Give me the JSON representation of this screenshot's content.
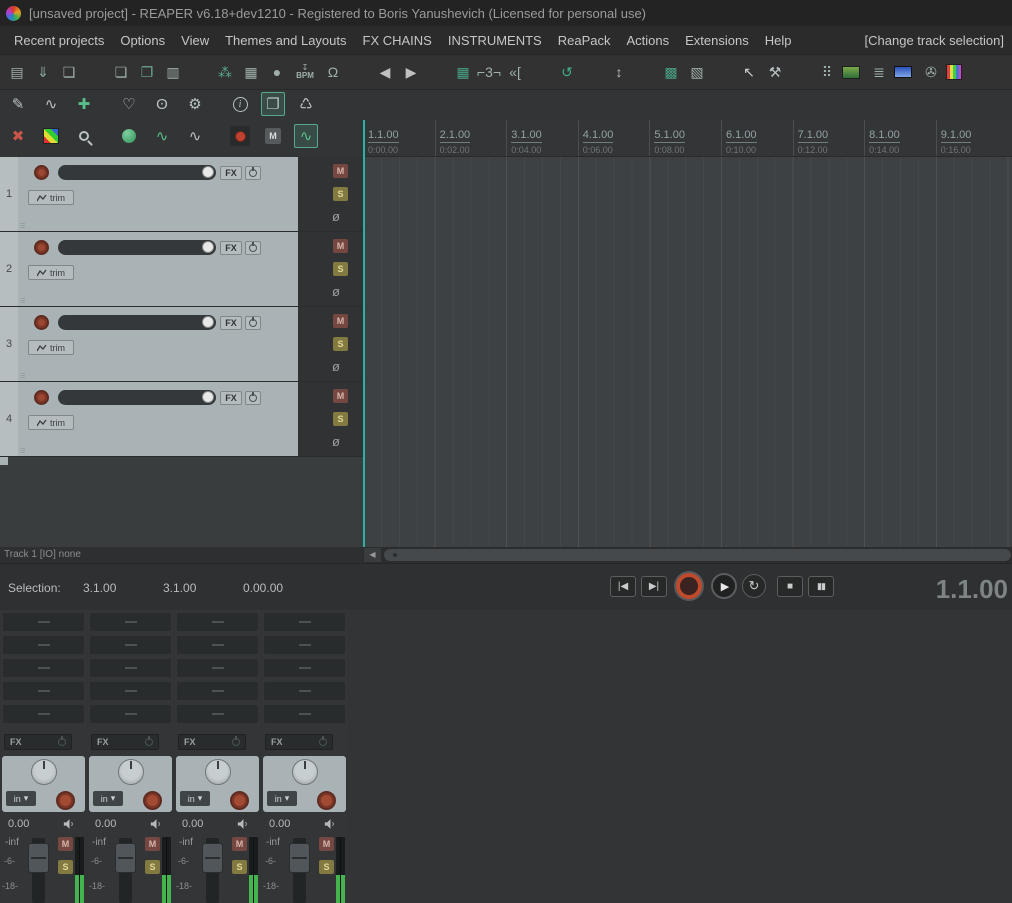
{
  "title_bar": {
    "title": "[unsaved project] - REAPER v6.18+dev1210 - Registered to Boris Yanushevich (Licensed for personal use)"
  },
  "menu": {
    "items": [
      "Recent projects",
      "Options",
      "View",
      "Themes and Layouts",
      "FX CHAINS",
      "INSTRUMENTS",
      "ReaPack",
      "Actions",
      "Extensions",
      "Help"
    ],
    "right_item": "[Change track selection]"
  },
  "toolbar": {
    "bpm_arrow": "↧",
    "bpm_label": "BPM",
    "routing_glyph": "≣",
    "tape_glyph": "✇",
    "icons_a": [
      {
        "name": "save-project-icon",
        "glyph": "▤",
        "color": "#9fb0aa"
      },
      {
        "name": "render-project-icon",
        "glyph": "⇓",
        "color": "#8fae9f"
      },
      {
        "name": "project-bay-icon",
        "glyph": "❑",
        "color": "#9fb0aa"
      },
      {
        "name": "spacer",
        "glyph": ""
      },
      {
        "name": "new-project-icon",
        "glyph": "❏",
        "color": "#9fb0aa"
      },
      {
        "name": "open-project-icon",
        "glyph": "❐",
        "color": "#6aa88f"
      },
      {
        "name": "media-explorer-icon",
        "glyph": "▥",
        "color": "#9fb0aa"
      },
      {
        "name": "spacer",
        "glyph": ""
      },
      {
        "name": "track-manager-icon",
        "glyph": "⁂",
        "color": "#5aa88a"
      },
      {
        "name": "big-clock-icon",
        "glyph": "▦",
        "color": "#9fb0aa"
      },
      {
        "name": "metronome-icon",
        "glyph": "●",
        "color": "#9fb0aa"
      }
    ],
    "icons_b": [
      {
        "name": "metronome-bell-icon",
        "glyph": "Ω",
        "color": "#9fb0aa"
      },
      {
        "name": "spacer",
        "glyph": ""
      },
      {
        "name": "go-start-arrow-icon",
        "glyph": "◀",
        "color": "#c0c0c0"
      },
      {
        "name": "play-arrow-icon",
        "glyph": "▶",
        "color": "#c0c0c0"
      },
      {
        "name": "spacer",
        "glyph": ""
      },
      {
        "name": "grid-toggle-icon",
        "glyph": "▦",
        "color": "#49a186"
      },
      {
        "name": "measure-grid-icon",
        "glyph": "⌐3¬",
        "color": "#9fb0aa"
      },
      {
        "name": "snap-toggle-icon",
        "glyph": "«[",
        "color": "#9fb0aa"
      },
      {
        "name": "spacer",
        "glyph": ""
      },
      {
        "name": "repeat-toggle-icon",
        "glyph": "↺",
        "color": "#3fae8c"
      },
      {
        "name": "spacer",
        "glyph": ""
      },
      {
        "name": "zoom-vertical-icon",
        "glyph": "↕",
        "color": "#b9c2c4"
      },
      {
        "name": "spacer",
        "glyph": ""
      },
      {
        "name": "item-select-grid-icon",
        "glyph": "▩",
        "color": "#49a186"
      },
      {
        "name": "marquee-zoom-icon",
        "glyph": "▧",
        "color": "#9fb0aa"
      },
      {
        "name": "spacer",
        "glyph": ""
      },
      {
        "name": "arrow-cursor-icon",
        "glyph": "↖",
        "color": "#d0d0d0"
      },
      {
        "name": "hammer-tool-icon",
        "glyph": "⚒",
        "color": "#b9c2c4"
      },
      {
        "name": "spacer",
        "glyph": ""
      },
      {
        "name": "dot-grid-icon",
        "glyph": "⠿",
        "color": "#9fb0aa"
      }
    ]
  },
  "tcp_toolbar": {
    "edit": "✎",
    "envelope": "∿",
    "add": "✚",
    "heart": "♡",
    "mic": "ʘ",
    "wrench": "⚙",
    "info": "i",
    "duplicate": "❐",
    "trash": "♺",
    "close": "✖",
    "env_a": "∿",
    "env_b": "∿",
    "mute": "M",
    "env_active": "∿"
  },
  "ruler": {
    "marks": [
      {
        "beat": "1.1.00",
        "time": "0:00.00"
      },
      {
        "beat": "2.1.00",
        "time": "0:02.00"
      },
      {
        "beat": "3.1.00",
        "time": "0:04.00"
      },
      {
        "beat": "4.1.00",
        "time": "0:06.00"
      },
      {
        "beat": "5.1.00",
        "time": "0:08.00"
      },
      {
        "beat": "6.1.00",
        "time": "0:10.00"
      },
      {
        "beat": "7.1.00",
        "time": "0:12.00"
      },
      {
        "beat": "8.1.00",
        "time": "0:14.00"
      },
      {
        "beat": "9.1.00",
        "time": "0:16.00"
      }
    ]
  },
  "tracks": {
    "items": [
      {
        "number": "1",
        "fx": "FX",
        "trim": "trim",
        "mute": "M",
        "solo": "S",
        "phase": "ø",
        "grip": "☰"
      },
      {
        "number": "2",
        "fx": "FX",
        "trim": "trim",
        "mute": "M",
        "solo": "S",
        "phase": "ø",
        "grip": "☰"
      },
      {
        "number": "3",
        "fx": "FX",
        "trim": "trim",
        "mute": "M",
        "solo": "S",
        "phase": "ø",
        "grip": "☰"
      },
      {
        "number": "4",
        "fx": "FX",
        "trim": "trim",
        "mute": "M",
        "solo": "S",
        "phase": "ø",
        "grip": "☰"
      }
    ]
  },
  "status": {
    "track_info": "Track 1 [IO] none"
  },
  "scrollbar": {
    "left_arrow": "◀"
  },
  "transport": {
    "selection_label": "Selection:",
    "selection_start": "3.1.00",
    "selection_end": "3.1.00",
    "selection_length": "0.00.00",
    "go_start": "|◀",
    "go_end": "▶|",
    "play": "▶",
    "loop": "↻",
    "stop": "■",
    "pause": "▮▮",
    "position": "1.1.00"
  },
  "mixer": {
    "strips": [
      {
        "fx": "FX",
        "input": "in",
        "input_arrow": "▾",
        "volume": "0.00",
        "peak": "-inf",
        "scale1": "-6-",
        "scale2": "-18-",
        "mute": "M",
        "solo": "S"
      },
      {
        "fx": "FX",
        "input": "in",
        "input_arrow": "▾",
        "volume": "0.00",
        "peak": "-inf",
        "scale1": "-6-",
        "scale2": "-18-",
        "mute": "M",
        "solo": "S"
      },
      {
        "fx": "FX",
        "input": "in",
        "input_arrow": "▾",
        "volume": "0.00",
        "peak": "-inf",
        "scale1": "-6-",
        "scale2": "-18-",
        "mute": "M",
        "solo": "S"
      },
      {
        "fx": "FX",
        "input": "in",
        "input_arrow": "▾",
        "volume": "0.00",
        "peak": "-inf",
        "scale1": "-6-",
        "scale2": "-18-",
        "mute": "M",
        "solo": "S"
      }
    ]
  }
}
